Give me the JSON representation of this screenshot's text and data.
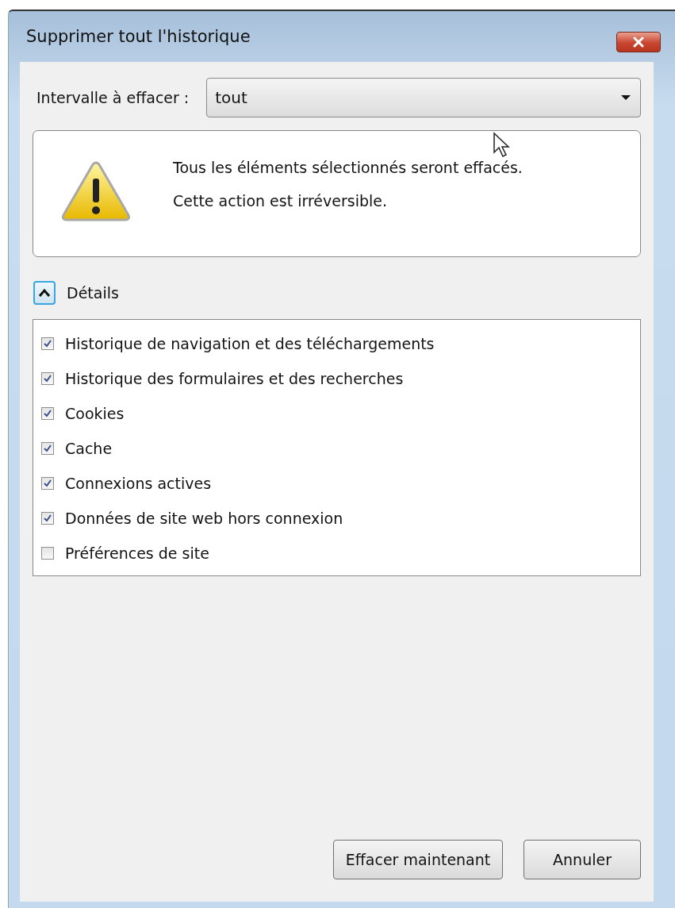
{
  "window": {
    "title": "Supprimer tout l'historique"
  },
  "range": {
    "label": "Intervalle à effacer :",
    "value": "tout"
  },
  "warning": {
    "lines": [
      "Tous les éléments sélectionnés seront effacés.",
      "Cette action est irréversible."
    ]
  },
  "details": {
    "label": "Détails",
    "expanded": true
  },
  "items": [
    {
      "label": "Historique de navigation et des téléchargements",
      "checked": true
    },
    {
      "label": "Historique des formulaires et des recherches",
      "checked": true
    },
    {
      "label": "Cookies",
      "checked": true
    },
    {
      "label": "Cache",
      "checked": true
    },
    {
      "label": "Connexions actives",
      "checked": true
    },
    {
      "label": "Données de site web hors connexion",
      "checked": true
    },
    {
      "label": "Préférences de site",
      "checked": false
    }
  ],
  "buttons": [
    "Effacer maintenant",
    "Annuler"
  ]
}
